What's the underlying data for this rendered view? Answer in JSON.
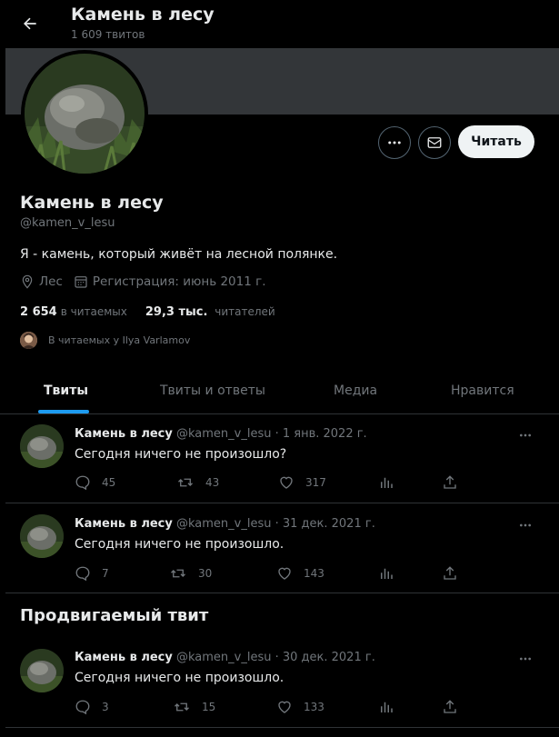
{
  "header": {
    "title": "Камень в лесу",
    "subtitle": "1 609 твитов"
  },
  "profile": {
    "name": "Камень в лесу",
    "handle": "@kamen_v_lesu",
    "bio": "Я - камень, который живёт на лесной полянке.",
    "location": "Лес",
    "joined": "Регистрация: июнь 2011 г.",
    "following_count": "2 654",
    "following_label": "в читаемых",
    "followers_count": "29,3 тыс.",
    "followers_label": "читателей",
    "followed_by": "В читаемых у Ilya Varlamov",
    "follow_button": "Читать"
  },
  "tabs": [
    "Твиты",
    "Твиты и ответы",
    "Медиа",
    "Нравится"
  ],
  "tweets": [
    {
      "name": "Камень в лесу",
      "meta": "@kamen_v_lesu · 1 янв. 2022 г.",
      "text": "Сегодня ничего не произошло?",
      "replies": "45",
      "retweets": "43",
      "likes": "317"
    },
    {
      "name": "Камень в лесу",
      "meta": "@kamen_v_lesu · 31 дек. 2021 г.",
      "text": "Сегодня ничего не произошло.",
      "replies": "7",
      "retweets": "30",
      "likes": "143"
    },
    {
      "name": "Камень в лесу",
      "meta": "@kamen_v_lesu · 30 дек. 2021 г.",
      "text": "Сегодня ничего не произошло.",
      "replies": "3",
      "retweets": "15",
      "likes": "133"
    }
  ],
  "promoted_heading": "Продвигаемый твит",
  "colors": {
    "accent": "#1d9bf0",
    "background": "#000000",
    "muted": "#71767b"
  }
}
